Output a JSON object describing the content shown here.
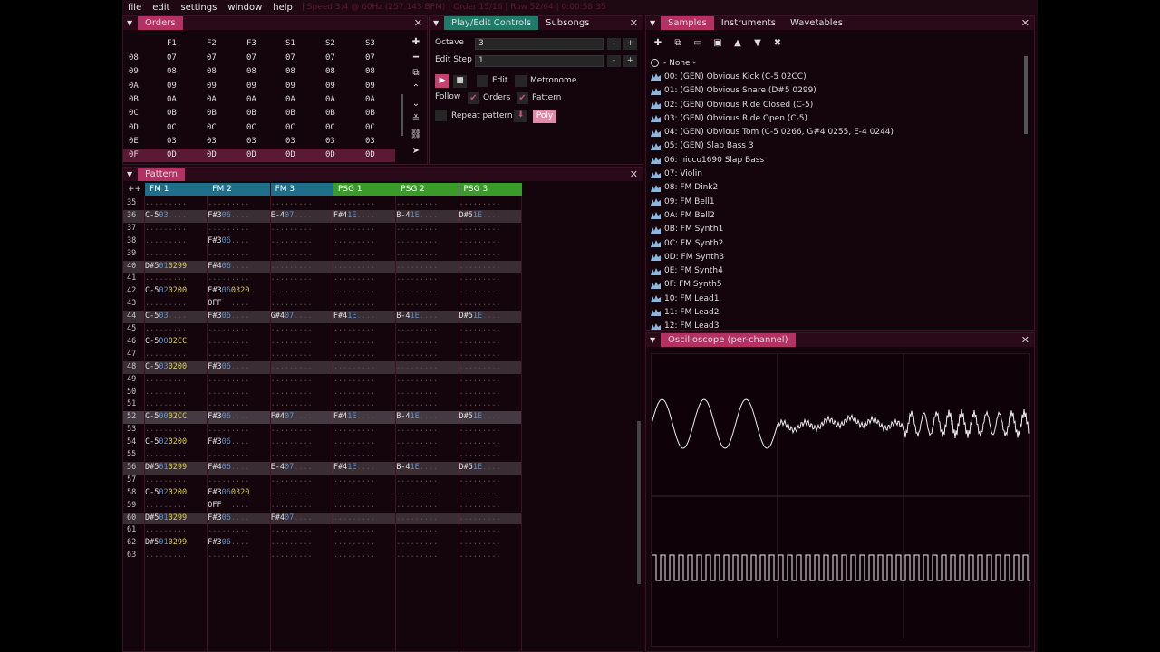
{
  "menubar": {
    "items": [
      "file",
      "edit",
      "settings",
      "window",
      "help"
    ],
    "status": "| Speed 3:4 @ 60Hz (257.143 BPM) | Order 15/16 | Row 52/64 | 0:00:58:35"
  },
  "orders": {
    "title": "Orders",
    "headers": [
      "F1",
      "F2",
      "F3",
      "S1",
      "S2",
      "S3"
    ],
    "rows": [
      [
        "08",
        "07",
        "07",
        "07",
        "07",
        "07",
        "07"
      ],
      [
        "09",
        "08",
        "08",
        "08",
        "08",
        "08",
        "08"
      ],
      [
        "0A",
        "09",
        "09",
        "09",
        "09",
        "09",
        "09"
      ],
      [
        "0B",
        "0A",
        "0A",
        "0A",
        "0A",
        "0A",
        "0A"
      ],
      [
        "0C",
        "0B",
        "0B",
        "0B",
        "0B",
        "0B",
        "0B"
      ],
      [
        "0D",
        "0C",
        "0C",
        "0C",
        "0C",
        "0C",
        "0C"
      ],
      [
        "0E",
        "03",
        "03",
        "03",
        "03",
        "03",
        "03"
      ],
      [
        "0F",
        "0D",
        "0D",
        "0D",
        "0D",
        "0D",
        "0D"
      ]
    ]
  },
  "play": {
    "tabs": [
      "Play/Edit Controls",
      "Subsongs"
    ],
    "octave_label": "Octave",
    "octave_value": "3",
    "editstep_label": "Edit Step",
    "editstep_value": "1",
    "edit_label": "Edit",
    "metronome_label": "Metronome",
    "follow_label": "Follow",
    "orders_label": "Orders",
    "pattern_label": "Pattern",
    "repeat_label": "Repeat pattern",
    "poly_label": "Poly"
  },
  "pattern": {
    "title": "Pattern",
    "corner": "++",
    "channels": [
      {
        "name": "FM 1",
        "color": "#1f6f8b"
      },
      {
        "name": "FM 2",
        "color": "#1f6f8b"
      },
      {
        "name": "FM 3",
        "color": "#1f6f8b"
      },
      {
        "name": "PSG 1",
        "color": "#3a9a2a"
      },
      {
        "name": "PSG 2",
        "color": "#3a9a2a"
      },
      {
        "name": "PSG 3",
        "color": "#3a9a2a"
      }
    ],
    "rows": [
      {
        "n": "35",
        "c": [
          "",
          "",
          "",
          "",
          "",
          ""
        ]
      },
      {
        "n": "36",
        "c": [
          "C-5|03|",
          "F#3|06|",
          "E-4|07|",
          "F#4|1E|",
          "B-4|1E|",
          "D#5|1E|"
        ]
      },
      {
        "n": "37",
        "c": [
          "",
          "",
          "",
          "",
          "",
          ""
        ]
      },
      {
        "n": "38",
        "c": [
          "",
          "F#3|06|",
          "",
          "",
          "",
          ""
        ]
      },
      {
        "n": "39",
        "c": [
          "",
          "",
          "",
          "",
          "",
          ""
        ]
      },
      {
        "n": "40",
        "c": [
          "D#5|01|0299",
          "F#4|06|",
          "",
          "",
          "",
          ""
        ]
      },
      {
        "n": "41",
        "c": [
          "",
          "",
          "",
          "",
          "",
          ""
        ]
      },
      {
        "n": "42",
        "c": [
          "C-5|02|0200",
          "F#3|06|0320",
          "",
          "",
          "",
          ""
        ]
      },
      {
        "n": "43",
        "c": [
          "",
          "OFF||",
          "",
          "",
          "",
          ""
        ]
      },
      {
        "n": "44",
        "c": [
          "C-5|03|",
          "F#3|06|",
          "G#4|07|",
          "F#4|1E|",
          "B-4|1E|",
          "D#5|1E|"
        ]
      },
      {
        "n": "45",
        "c": [
          "",
          "",
          "",
          "",
          "",
          ""
        ]
      },
      {
        "n": "46",
        "c": [
          "C-5|00|02CC",
          "",
          "",
          "",
          "",
          ""
        ]
      },
      {
        "n": "47",
        "c": [
          "",
          "",
          "",
          "",
          "",
          ""
        ]
      },
      {
        "n": "48",
        "c": [
          "C-5|03|0200",
          "F#3|06|",
          "",
          "",
          "",
          ""
        ]
      },
      {
        "n": "49",
        "c": [
          "",
          "",
          "",
          "",
          "",
          ""
        ]
      },
      {
        "n": "50",
        "c": [
          "",
          "",
          "",
          "",
          "",
          ""
        ]
      },
      {
        "n": "51",
        "c": [
          "",
          "",
          "",
          "",
          "",
          ""
        ]
      },
      {
        "n": "52",
        "c": [
          "C-5|00|02CC",
          "F#3|06|",
          "F#4|07|",
          "F#4|1E|",
          "B-4|1E|",
          "D#5|1E|"
        ]
      },
      {
        "n": "53",
        "c": [
          "",
          "",
          "",
          "",
          "",
          ""
        ]
      },
      {
        "n": "54",
        "c": [
          "C-5|02|0200",
          "F#3|06|",
          "",
          "",
          "",
          ""
        ]
      },
      {
        "n": "55",
        "c": [
          "",
          "",
          "",
          "",
          "",
          ""
        ]
      },
      {
        "n": "56",
        "c": [
          "D#5|01|0299",
          "F#4|06|",
          "E-4|07|",
          "F#4|1E|",
          "B-4|1E|",
          "D#5|1E|"
        ]
      },
      {
        "n": "57",
        "c": [
          "",
          "",
          "",
          "",
          "",
          ""
        ]
      },
      {
        "n": "58",
        "c": [
          "C-5|02|0200",
          "F#3|06|0320",
          "",
          "",
          "",
          ""
        ]
      },
      {
        "n": "59",
        "c": [
          "",
          "OFF||",
          "",
          "",
          "",
          ""
        ]
      },
      {
        "n": "60",
        "c": [
          "D#5|01|0299",
          "F#3|06|",
          "F#4|07|",
          "",
          "",
          ""
        ]
      },
      {
        "n": "61",
        "c": [
          "",
          "",
          "",
          "",
          "",
          ""
        ]
      },
      {
        "n": "62",
        "c": [
          "D#5|01|0299",
          "F#3|06|",
          "",
          "",
          "",
          ""
        ]
      },
      {
        "n": "63",
        "c": [
          "",
          "",
          "",
          "",
          "",
          ""
        ]
      }
    ]
  },
  "samples": {
    "tabs": [
      "Samples",
      "Instruments",
      "Wavetables"
    ],
    "none_label": "- None -",
    "items": [
      "00: (GEN) Obvious Kick (C-5 02CC)",
      "01: (GEN) Obvious Snare (D#5 0299)",
      "02: (GEN) Obvious Ride Closed (C-5)",
      "03: (GEN) Obvious Ride Open (C-5)",
      "04: (GEN) Obvious Tom (C-5 0266, G#4 0255, E-4 0244)",
      "05: (GEN) Slap Bass 3",
      "06: nicco1690 Slap Bass",
      "07: Violin",
      "08: FM Dink2",
      "09: FM Bell1",
      "0A: FM Bell2",
      "0B: FM Synth1",
      "0C: FM Synth2",
      "0D: FM Synth3",
      "0E: FM Synth4",
      "0F: FM Synth5",
      "10: FM Lead1",
      "11: FM Lead2",
      "12: FM Lead3"
    ]
  },
  "oscilloscope": {
    "title": "Oscilloscope (per-channel)"
  },
  "colors": {
    "accent": "#c4426f",
    "panel": "#14040b",
    "fm": "#1f6f8b",
    "psg": "#3a9a2a",
    "effect": "#d9d24b",
    "instrument": "#5f93c9"
  }
}
